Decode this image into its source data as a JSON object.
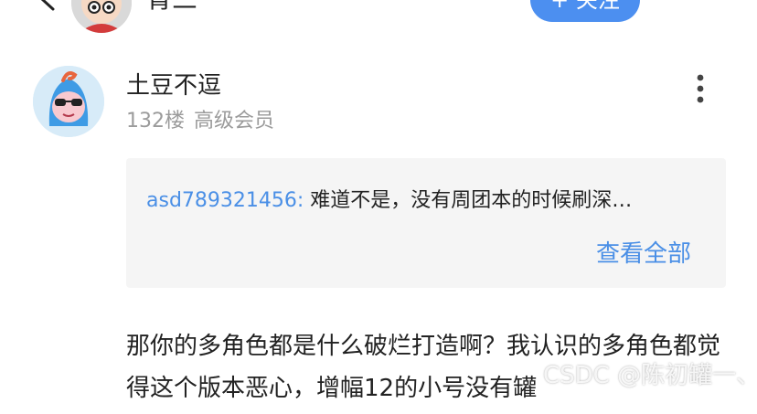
{
  "header": {
    "username": "青三",
    "follow_label": "+ 关注"
  },
  "post": {
    "username": "土豆不逗",
    "floor": "132楼",
    "level": "高级会员",
    "quote": {
      "user": "asd789321456:",
      "text": " 难道不是，没有周团本的时候刷深…",
      "view_all": "查看全部"
    },
    "body": "那你的多角色都是什么破烂打造啊？我认识的多角色都觉得这个版本恶心，增幅12的小号没有罐"
  },
  "watermark": "CSDC @陈初罐一、",
  "colors": {
    "accent": "#4a8fe6",
    "button": "#4c8ff0",
    "quote_bg": "#f5f5f5",
    "meta": "#9b9b9b"
  },
  "icons": {
    "back": "chevron-left-icon",
    "top_more": "more-horizontal-icon",
    "post_more": "more-vertical-icon"
  }
}
